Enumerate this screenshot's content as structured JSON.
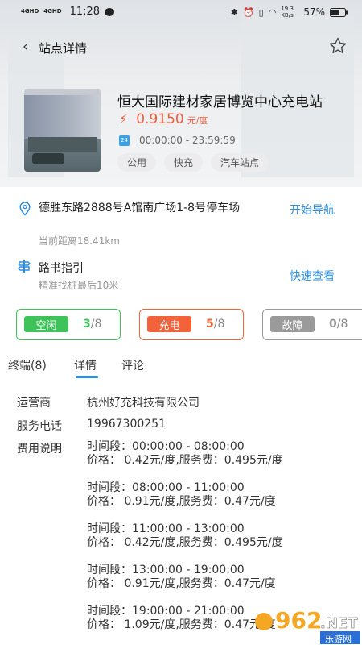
{
  "status_bar": {
    "net1": "4GHD",
    "net2": "4GHD",
    "time": "11:28",
    "speed": "19.3 KB/s",
    "battery": "57%"
  },
  "nav": {
    "title": "站点详情"
  },
  "station": {
    "name": "恒大国际建材家居博览中心充电站",
    "price": "0.9150",
    "price_unit": "元/度",
    "hours_badge": "24",
    "hours": "00:00:00 - 23:59:59",
    "tags": [
      "公用",
      "快充",
      "汽车站点"
    ]
  },
  "address": {
    "text": "德胜东路2888号A馆南广场1-8号停车场",
    "distance": "当前距离18.41km",
    "nav_link": "开始导航"
  },
  "guide": {
    "title": "路书指引",
    "subtitle": "精准找桩最后10米",
    "link": "快速查看"
  },
  "stats": [
    {
      "label": "空闲",
      "count": "3",
      "total": "/8",
      "color": "#3ec35a"
    },
    {
      "label": "充电",
      "count": "5",
      "total": "/8",
      "color": "#f4623a"
    },
    {
      "label": "故障",
      "count": "0",
      "total": "/8",
      "color": "#9a9a9a"
    }
  ],
  "tabs": [
    "终端(8)",
    "详情",
    "评论"
  ],
  "details": {
    "operator_label": "运营商",
    "operator": "杭州好充科技有限公司",
    "phone_label": "服务电话",
    "phone": "19967300251",
    "fee_label": "费用说明",
    "fees": [
      {
        "period": "时间段：00:00:00 - 08:00:00",
        "price": "价格：  0.42元/度,服务费：0.495元/度"
      },
      {
        "period": "时间段：08:00:00 - 11:00:00",
        "price": "价格：  0.91元/度,服务费：0.47元/度"
      },
      {
        "period": "时间段：11:00:00 - 13:00:00",
        "price": "价格：  0.42元/度,服务费：0.495元/度"
      },
      {
        "period": "时间段：13:00:00 - 19:00:00",
        "price": "价格：  0.91元/度,服务费：0.47元/度"
      },
      {
        "period": "时间段：19:00:00 - 21:00:00",
        "price": "价格：  1.09元/度,服务费：0.47元/度"
      }
    ]
  },
  "watermark": {
    "number": "962",
    "suffix": ".NET",
    "sub": "乐游网"
  }
}
